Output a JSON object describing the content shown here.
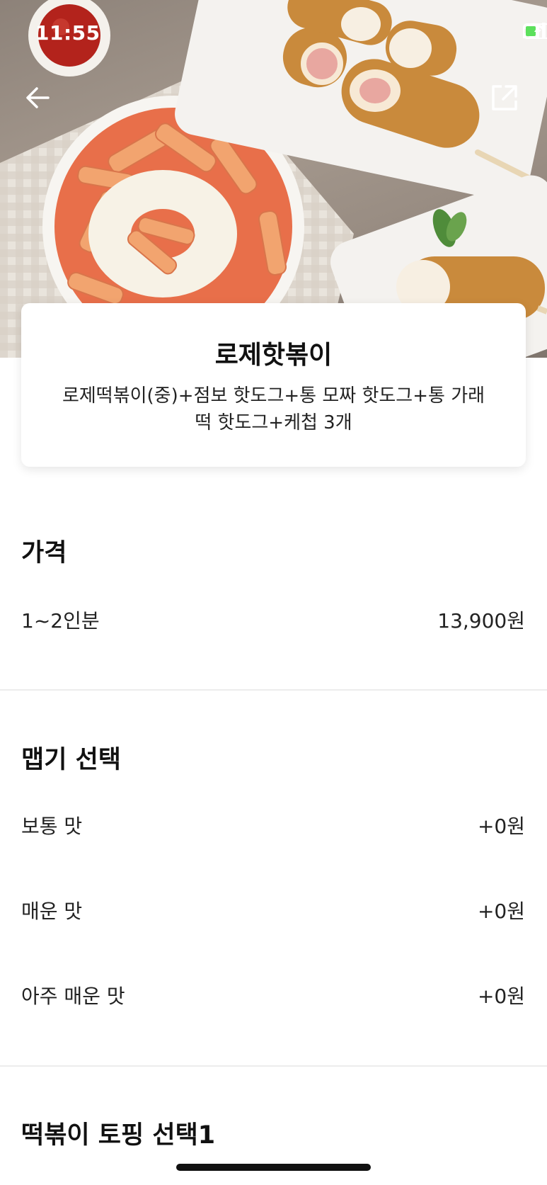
{
  "status_bar": {
    "time": "11:55"
  },
  "header": {
    "back_icon": "arrow-left-icon",
    "share_icon": "share-icon"
  },
  "product": {
    "name": "로제핫볶이",
    "description": "로제떡볶이(중)+점보 핫도그+통 모짜 핫도그+통 가래떡 핫도그+케첩 3개"
  },
  "price_section": {
    "title": "가격",
    "rows": [
      {
        "label": "1~2인분",
        "price": "13,900원"
      }
    ]
  },
  "spice_section": {
    "title": "맵기 선택",
    "options": [
      {
        "label": "보통 맛",
        "price": "+0원"
      },
      {
        "label": "매운 맛",
        "price": "+0원"
      },
      {
        "label": "아주 매운 맛",
        "price": "+0원"
      }
    ]
  },
  "topping_section": {
    "title": "떡볶이 토핑 선택1"
  }
}
